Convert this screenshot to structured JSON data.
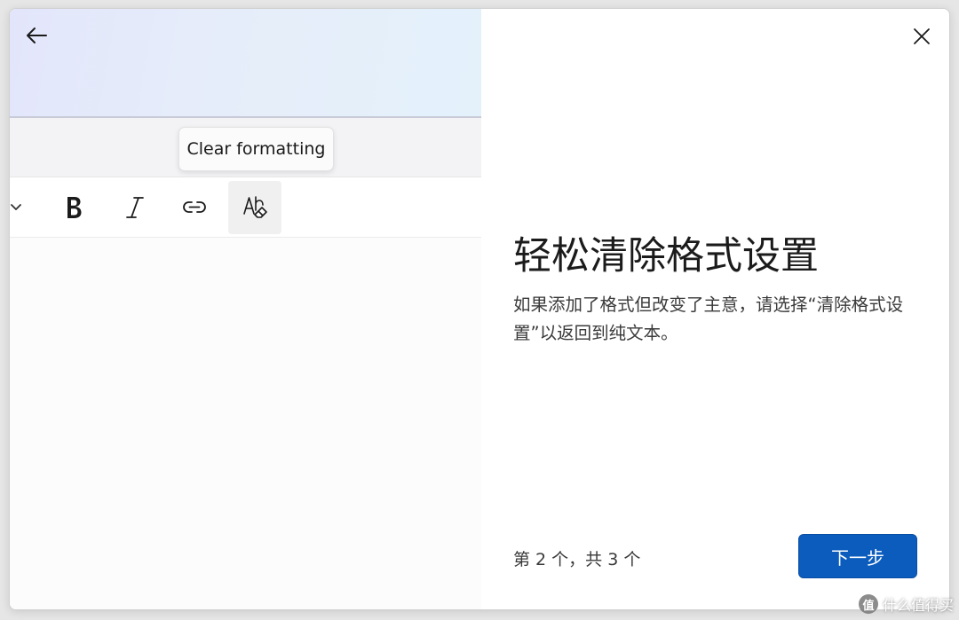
{
  "nav": {
    "back_icon": "arrow-left-icon",
    "close_icon": "close-icon"
  },
  "preview": {
    "tooltip_text": "Clear formatting",
    "toolbar_icons": [
      "chevron-down-icon",
      "bold-icon",
      "italic-icon",
      "link-icon",
      "clear-formatting-icon"
    ],
    "active_icon": "clear-formatting-icon"
  },
  "content": {
    "heading": "轻松清除格式设置",
    "description": "如果添加了格式但改变了主意，请选择“清除格式设置”以返回到纯文本。"
  },
  "footer": {
    "step_text": "第 2 个，共 3 个",
    "next_label": "下一步"
  },
  "watermark": {
    "badge": "值",
    "text": "什么值得买"
  },
  "colors": {
    "accent": "#0b5cbd",
    "hero_start": "#e3e6fb",
    "hero_end": "#e4f1fb"
  }
}
